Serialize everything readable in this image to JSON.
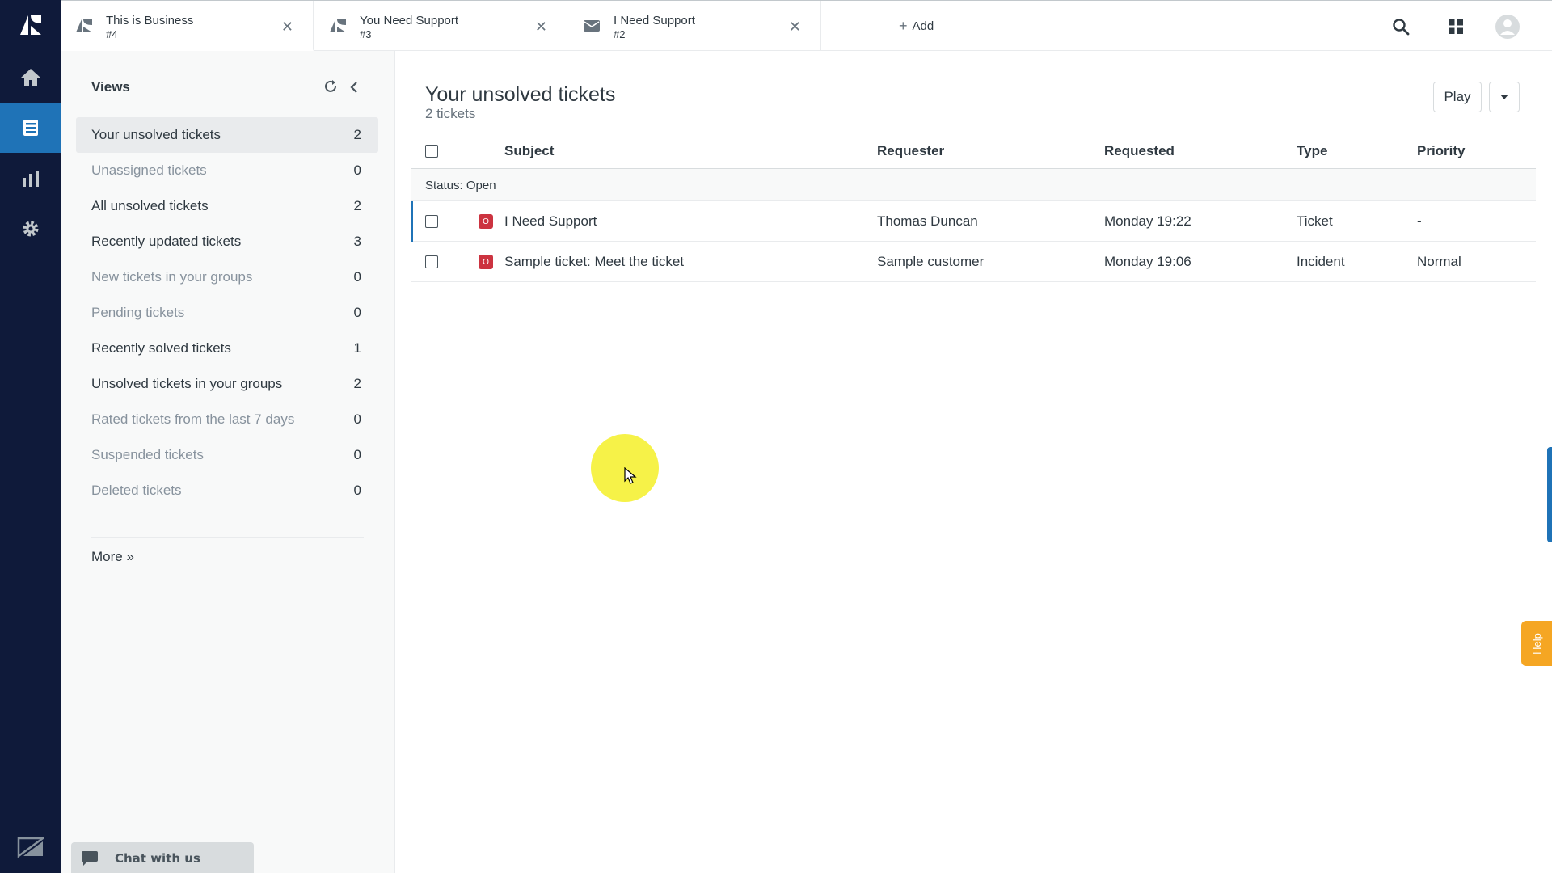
{
  "tabs": [
    {
      "title": "This is Business",
      "number": "#4",
      "icon": "ticket-icon"
    },
    {
      "title": "You Need Support",
      "number": "#3",
      "icon": "ticket-icon"
    },
    {
      "title": "I Need Support",
      "number": "#2",
      "icon": "mail-icon"
    }
  ],
  "add_tab_label": "Add",
  "views": {
    "title": "Views",
    "items": [
      {
        "label": "Your unsolved tickets",
        "count": "2",
        "active": true,
        "muted": false
      },
      {
        "label": "Unassigned tickets",
        "count": "0",
        "active": false,
        "muted": true
      },
      {
        "label": "All unsolved tickets",
        "count": "2",
        "active": false,
        "muted": false
      },
      {
        "label": "Recently updated tickets",
        "count": "3",
        "active": false,
        "muted": false
      },
      {
        "label": "New tickets in your groups",
        "count": "0",
        "active": false,
        "muted": true
      },
      {
        "label": "Pending tickets",
        "count": "0",
        "active": false,
        "muted": true
      },
      {
        "label": "Recently solved tickets",
        "count": "1",
        "active": false,
        "muted": false
      },
      {
        "label": "Unsolved tickets in your groups",
        "count": "2",
        "active": false,
        "muted": false
      },
      {
        "label": "Rated tickets from the last 7 days",
        "count": "0",
        "active": false,
        "muted": true
      },
      {
        "label": "Suspended tickets",
        "count": "0",
        "active": false,
        "muted": true
      },
      {
        "label": "Deleted tickets",
        "count": "0",
        "active": false,
        "muted": true
      }
    ],
    "more_label": "More »"
  },
  "chat": {
    "label": "Chat with us"
  },
  "main": {
    "title": "Your unsolved tickets",
    "subtitle": "2 tickets",
    "play_label": "Play",
    "columns": {
      "subject": "Subject",
      "requester": "Requester",
      "requested": "Requested",
      "type": "Type",
      "priority": "Priority"
    },
    "group": {
      "prefix": "Status:",
      "value": "Open"
    },
    "rows": [
      {
        "status_letter": "O",
        "subject": "I Need Support",
        "requester": "Thomas Duncan",
        "requested": "Monday 19:22",
        "type": "Ticket",
        "priority": "-"
      },
      {
        "status_letter": "O",
        "subject": "Sample ticket: Meet the ticket",
        "requester": "Sample customer",
        "requested": "Monday 19:06",
        "type": "Incident",
        "priority": "Normal"
      }
    ]
  },
  "help_label": "Help",
  "colors": {
    "rail": "#0f1a3a",
    "accent": "#1f73b7",
    "open_status": "#cc3340",
    "help": "#f5a623"
  }
}
